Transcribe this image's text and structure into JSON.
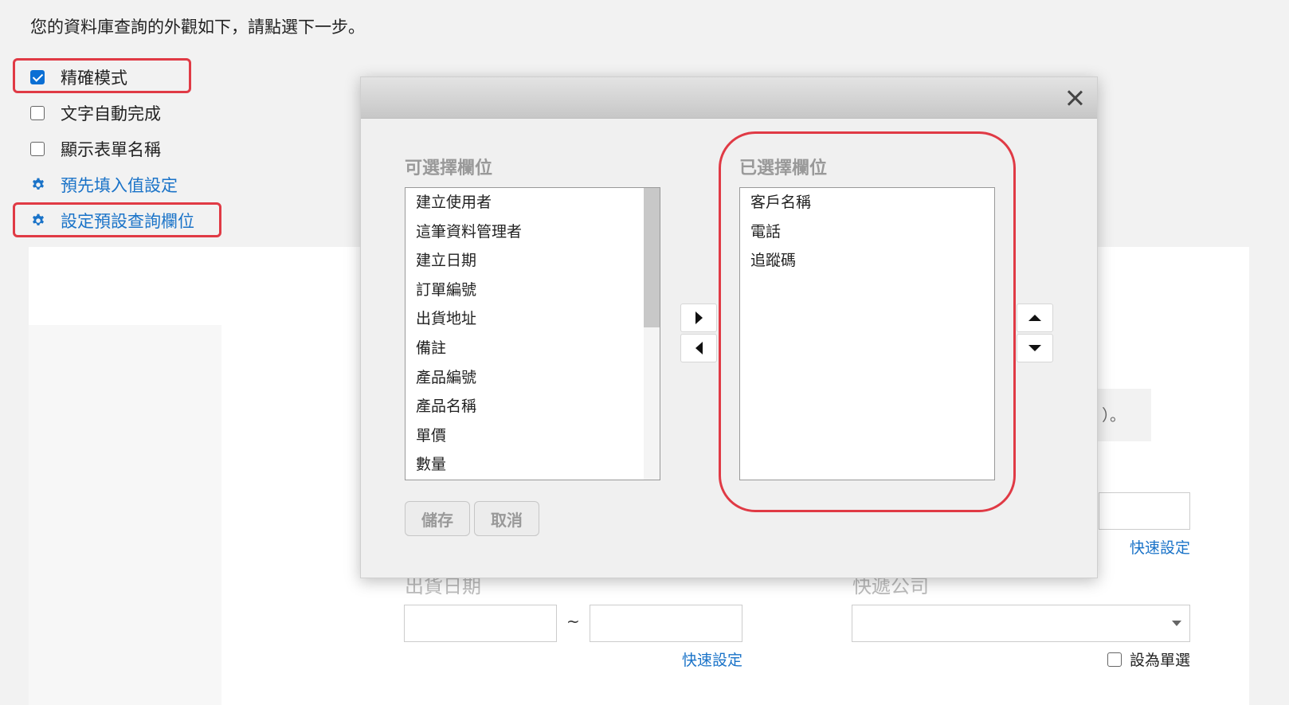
{
  "instruction": "您的資料庫查詢的外觀如下，請點選下一步。",
  "options": [
    {
      "label": "精確模式",
      "checked": true
    },
    {
      "label": "文字自動完成",
      "checked": false
    },
    {
      "label": "顯示表單名稱",
      "checked": false
    }
  ],
  "links": {
    "prefill": "預先填入值設定",
    "default_fields": "設定預設查詢欄位"
  },
  "background_form": {
    "partial_text": "）。",
    "ship_date_label": "出貨日期",
    "range_separator": "~",
    "courier_label": "快遞公司",
    "quick_set_1": "快速設定",
    "quick_set_2": "快速設定",
    "single_select_label": "設為單選"
  },
  "dialog": {
    "available_title": "可選擇欄位",
    "selected_title": "已選擇欄位",
    "available_fields": [
      "建立使用者",
      "這筆資料管理者",
      "建立日期",
      "訂單編號",
      "出貨地址",
      "備註",
      "產品編號",
      "產品名稱",
      "單價",
      "數量"
    ],
    "selected_fields": [
      "客戶名稱",
      "電話",
      "追蹤碼"
    ],
    "save_label": "儲存",
    "cancel_label": "取消"
  },
  "colors": {
    "accent": "#0a6fd4",
    "link": "#1a73c8",
    "highlight": "#e03a45"
  },
  "icons": {
    "settings": "gear-icon",
    "close": "close-icon",
    "move_right": "arrow-right-icon",
    "move_left": "arrow-left-icon",
    "move_up": "arrow-up-icon",
    "move_down": "arrow-down-icon",
    "dropdown": "caret-down-icon"
  }
}
